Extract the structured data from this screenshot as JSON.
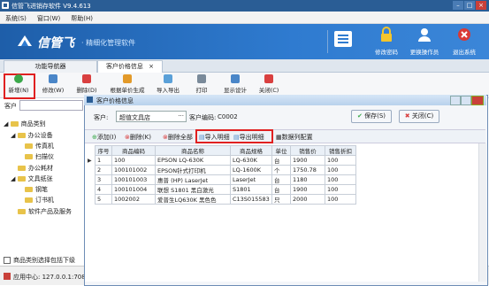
{
  "app": {
    "title": "信管飞进销存软件 V9.4.613",
    "window_buttons": [
      "–",
      "□",
      "×"
    ]
  },
  "menu": [
    "系统(S)",
    "窗口(W)",
    "帮助(H)"
  ],
  "banner": {
    "logo": "信管飞",
    "subtitle": "· 精细化管理软件",
    "buttons": [
      {
        "label": "修改密码"
      },
      {
        "label": "更换操作员"
      },
      {
        "label": "退出系统"
      }
    ]
  },
  "tabs": [
    {
      "label": "功能导航器"
    },
    {
      "label": "客户价格信息",
      "close": "×"
    }
  ],
  "toolbar": {
    "items": [
      "新增(N)",
      "修改(W)",
      "删除(D)",
      "根据单价生成",
      "导入导出",
      "打印",
      "显示设计",
      "关闭(C)"
    ]
  },
  "customer_label": "客户",
  "tree": {
    "root": "商品类别",
    "items": [
      {
        "label": "办公设备",
        "level": 1
      },
      {
        "label": "传真机",
        "level": 2
      },
      {
        "label": "扫描仪",
        "level": 2
      },
      {
        "label": "办公耗材",
        "level": 1
      },
      {
        "label": "文具纸张",
        "level": 1
      },
      {
        "label": "钢笔",
        "level": 2
      },
      {
        "label": "订书机",
        "level": 2
      },
      {
        "label": "软件产品及服务",
        "level": 1
      }
    ],
    "checkbox_label": "商品类别选择包括下级"
  },
  "statusbar": {
    "text": "应用中心: 127.0.0.1:7080"
  },
  "dialog": {
    "title": "客户价格信息",
    "customer_label": "客户:",
    "customer_value": "超值文具店",
    "customer_code_label": "客户编码:",
    "customer_code": "C0002",
    "save_label": "保存(S)",
    "close_label": "关闭(C)",
    "tools": [
      "添加(I)",
      "删除(K)",
      "删除全部",
      "导入明细",
      "导出明细",
      "数据列配置"
    ],
    "columns": [
      "序号",
      "商品编码",
      "商品名称",
      "商品规格",
      "单位",
      "销售价",
      "销售折扣"
    ],
    "rows": [
      [
        "1",
        "100",
        "EPSON LQ-630K",
        "LQ-630K",
        "台",
        "1900",
        "100"
      ],
      [
        "2",
        "100101002",
        "EPSON针式打印机",
        "LQ-1600K",
        "个",
        "1750.78",
        "100"
      ],
      [
        "3",
        "100101003",
        "惠普 (HP) LaserJet",
        "LaserJet",
        "台",
        "1180",
        "100"
      ],
      [
        "4",
        "100101004",
        "联想 S1801 黑白激光",
        "S1801",
        "台",
        "1900",
        "100"
      ],
      [
        "5",
        "1002002",
        "爱普生LQ630K 黑色色",
        "C13S015583",
        "只",
        "2000",
        "100"
      ]
    ]
  }
}
